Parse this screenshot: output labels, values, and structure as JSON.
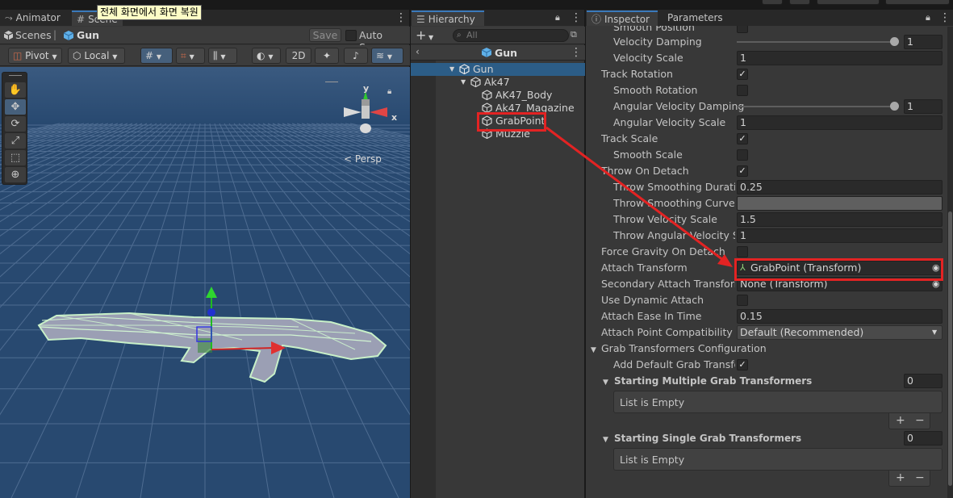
{
  "tooltip": "전체 화면에서 화면 복원",
  "scene_panel": {
    "tabs": [
      {
        "label": "Animator",
        "icon": "animator-icon"
      },
      {
        "label": "Scene",
        "icon": "grid-icon"
      }
    ],
    "breadcrumb": {
      "root": "Scenes",
      "separator": "|",
      "current": "Gun"
    },
    "save_label": "Save",
    "auto_save_label": "Auto Save",
    "auto_save_checked": false,
    "toolbar": {
      "pivot_label": "Pivot",
      "local_label": "Local",
      "mode_2d_label": "2D"
    },
    "persp_label": "Persp",
    "gizmo_axes": {
      "y": "y",
      "x": "x"
    }
  },
  "hierarchy": {
    "tab_label": "Hierarchy",
    "search_placeholder": "All",
    "scene_header": "Gun",
    "items": [
      {
        "label": "Gun",
        "depth": 0,
        "selected": true,
        "expanded": true
      },
      {
        "label": "Ak47",
        "depth": 1,
        "selected": false,
        "expanded": true
      },
      {
        "label": "AK47_Body",
        "depth": 2,
        "selected": false
      },
      {
        "label": "Ak47_Magazine",
        "depth": 2,
        "selected": false
      },
      {
        "label": "GrabPoint",
        "depth": 2,
        "selected": false,
        "highlighted": true
      },
      {
        "label": "Muzzle",
        "depth": 2,
        "selected": false
      }
    ]
  },
  "inspector": {
    "tabs": [
      {
        "label": "Inspector",
        "active": true,
        "icon": "info-icon"
      },
      {
        "label": "Parameters",
        "active": false
      }
    ],
    "rows": {
      "smooth_position": {
        "label": "Smooth Position",
        "checked": false
      },
      "velocity_damping": {
        "label": "Velocity Damping",
        "value": "1",
        "slider": 1
      },
      "velocity_scale": {
        "label": "Velocity Scale",
        "value": "1"
      },
      "track_rotation": {
        "label": "Track Rotation",
        "checked": true
      },
      "smooth_rotation": {
        "label": "Smooth Rotation",
        "checked": false
      },
      "angular_velocity_damping": {
        "label": "Angular Velocity Damping",
        "value": "1",
        "slider": 1
      },
      "angular_velocity_scale": {
        "label": "Angular Velocity Scale",
        "value": "1"
      },
      "track_scale": {
        "label": "Track Scale",
        "checked": true
      },
      "smooth_scale": {
        "label": "Smooth Scale",
        "checked": false
      },
      "throw_on_detach": {
        "label": "Throw On Detach",
        "checked": true
      },
      "throw_smoothing_duration": {
        "label": "Throw Smoothing Duration",
        "value": "0.25"
      },
      "throw_smoothing_curve": {
        "label": "Throw Smoothing Curve"
      },
      "throw_velocity_scale": {
        "label": "Throw Velocity Scale",
        "value": "1.5"
      },
      "throw_angular_velocity_scale": {
        "label": "Throw Angular Velocity Scale",
        "value": "1"
      },
      "force_gravity_on_detach": {
        "label": "Force Gravity On Detach",
        "checked": false
      },
      "attach_transform": {
        "label": "Attach Transform",
        "value": "GrabPoint (Transform)"
      },
      "secondary_attach_transform": {
        "label": "Secondary Attach Transform",
        "value": "None (Transform)"
      },
      "use_dynamic_attach": {
        "label": "Use Dynamic Attach",
        "checked": false
      },
      "attach_ease_in_time": {
        "label": "Attach Ease In Time",
        "value": "0.15"
      },
      "attach_point_compatibility_mode": {
        "label": "Attach Point Compatibility Mode",
        "value": "Default (Recommended)"
      },
      "grab_transformers_configuration": {
        "label": "Grab Transformers Configuration",
        "expanded": true
      },
      "add_default_grab_transformers": {
        "label": "Add Default Grab Transformers",
        "checked": true
      },
      "starting_multiple_grab_transformers": {
        "label": "Starting Multiple Grab Transformers",
        "count": "0",
        "list_text": "List is Empty"
      },
      "starting_single_grab_transformers": {
        "label": "Starting Single Grab Transformers",
        "count": "0",
        "list_text": "List is Empty"
      }
    },
    "list_add": "+",
    "list_remove": "−"
  },
  "colors": {
    "accent": "#3a79bb",
    "selection": "#2c5d87",
    "annotation": "#e32323",
    "viewport": "#284970"
  }
}
